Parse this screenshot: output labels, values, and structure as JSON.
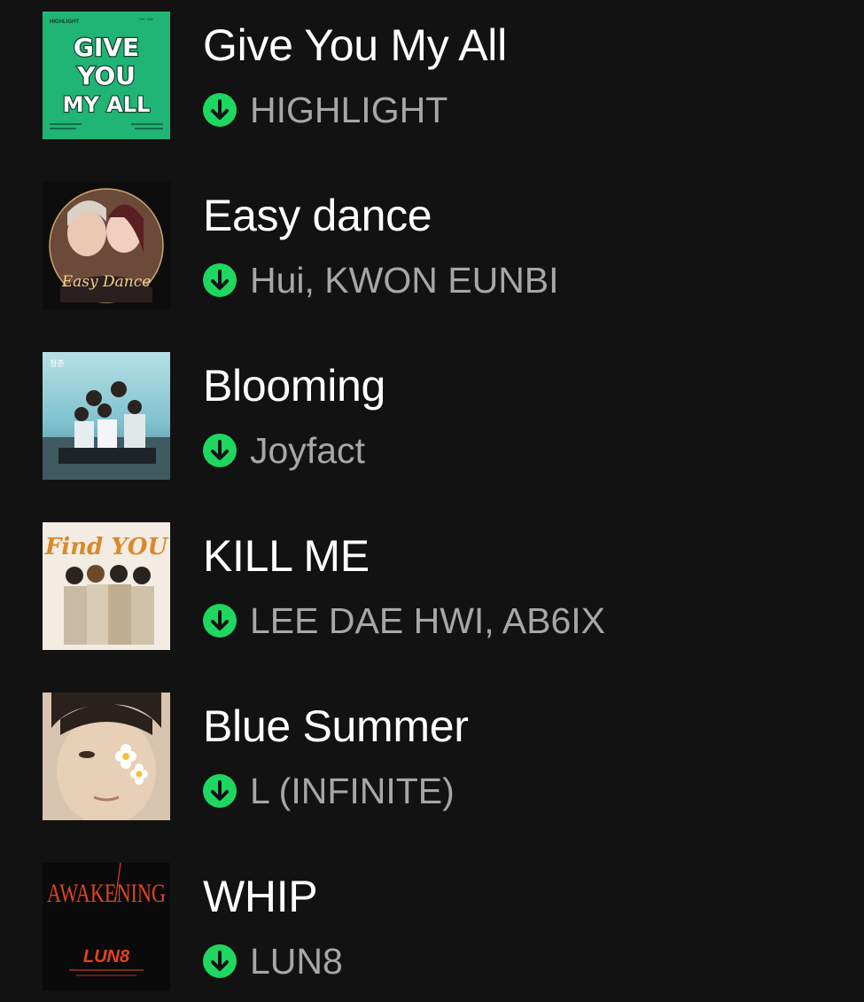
{
  "tracks": [
    {
      "title": "Give You My All",
      "artist": "HIGHLIGHT",
      "downloaded": true,
      "cover": {
        "bg": "#21b575",
        "lines": [
          "GIVE",
          "YOU",
          "MY ALL"
        ],
        "top_left": "HIGHLIGHT"
      }
    },
    {
      "title": "Easy dance",
      "artist": "Hui, KWON EUNBI",
      "downloaded": true,
      "cover": {
        "bg": "#0c0c0c",
        "text": "Easy Dance"
      }
    },
    {
      "title": "Blooming",
      "artist": "Joyfact",
      "downloaded": true,
      "cover": {
        "bg": "#8fc9d4"
      }
    },
    {
      "title": "KILL ME",
      "artist": "LEE DAE HWI, AB6IX",
      "downloaded": true,
      "cover": {
        "bg": "#f2ece2",
        "text": "Find YOU"
      }
    },
    {
      "title": "Blue Summer",
      "artist": "L (INFINITE)",
      "downloaded": true,
      "cover": {
        "bg": "#d8c4ae"
      }
    },
    {
      "title": "WHIP",
      "artist": "LUN8",
      "downloaded": true,
      "cover": {
        "bg": "#0a0a0a",
        "text_top": "AWAKENING",
        "text_mid": "LUN8"
      }
    }
  ],
  "colors": {
    "background": "#121212",
    "title": "#ffffff",
    "artist": "#a7a7a7",
    "download_badge": "#1ed760"
  },
  "icons": {
    "download": "download-arrow-icon"
  }
}
